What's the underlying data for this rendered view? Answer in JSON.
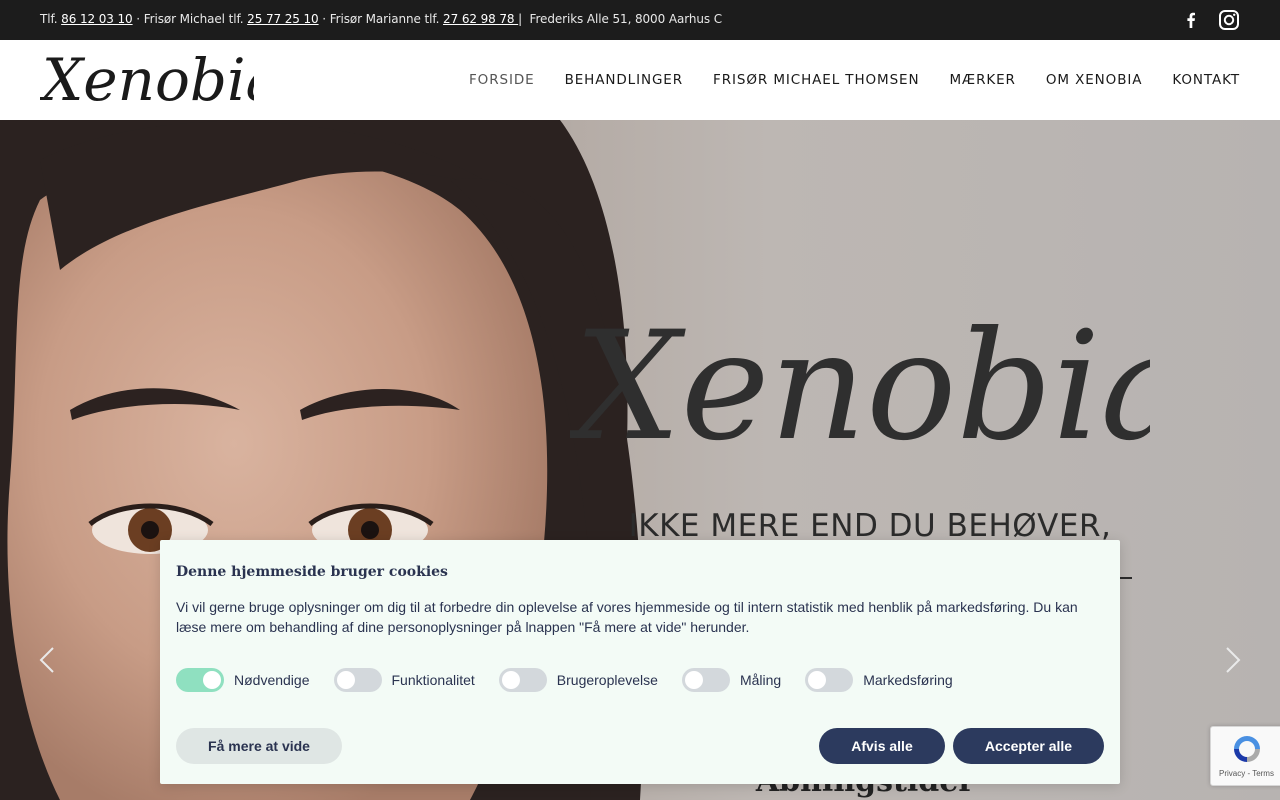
{
  "topbar": {
    "label_tlf": "Tlf. ",
    "phone_main": "86 12 03 10",
    "label_michael": " · Frisør Michael tlf. ",
    "phone_michael": "25 77 25 10",
    "label_marianne": " · Frisør Marianne tlf. ",
    "phone_marianne": "27 62 98 78 ",
    "separator": "|",
    "address": "  Frederiks Alle 51, 8000 Aarhus C",
    "social": [
      "facebook-icon",
      "instagram-icon"
    ]
  },
  "header": {
    "logo_text": "Xenobia",
    "nav": [
      {
        "label": "FORSIDE",
        "active": true
      },
      {
        "label": "BEHANDLINGER",
        "active": false
      },
      {
        "label": "FRISØR MICHAEL THOMSEN",
        "active": false
      },
      {
        "label": "MÆRKER",
        "active": false
      },
      {
        "label": "OM XENOBIA",
        "active": false
      },
      {
        "label": "KONTAKT",
        "active": false
      }
    ]
  },
  "hero": {
    "script_title": "Xenobia",
    "tagline": "IKKE MERE END DU BEHØVER,",
    "subheading": "Åbningstider",
    "prev_icon": "chevron-left-icon",
    "next_icon": "chevron-right-icon"
  },
  "cookie": {
    "title": "Denne hjemmeside bruger cookies",
    "text": "Vi vil gerne bruge oplysninger om dig til at forbedre din oplevelse af vores hjemmeside og til intern statistik med henblik på markedsføring. Du kan læse mere om behandling af dine personoplysninger på lnappen \"Få mere at vide\" herunder.",
    "toggles": [
      {
        "label": "Nødvendige",
        "on": true
      },
      {
        "label": "Funktionalitet",
        "on": false
      },
      {
        "label": "Brugeroplevelse",
        "on": false
      },
      {
        "label": "Måling",
        "on": false
      },
      {
        "label": "Markedsføring",
        "on": false
      }
    ],
    "learn_more": "Få mere at vide",
    "reject": "Afvis alle",
    "accept": "Accepter alle"
  },
  "recaptcha": {
    "links": "Privacy - Terms"
  },
  "colors": {
    "topbar_bg": "#1c1c1c",
    "cookie_bg": "#f3fbf6",
    "button_dark": "#2c3a5e",
    "toggle_on": "#8fe0c0"
  }
}
